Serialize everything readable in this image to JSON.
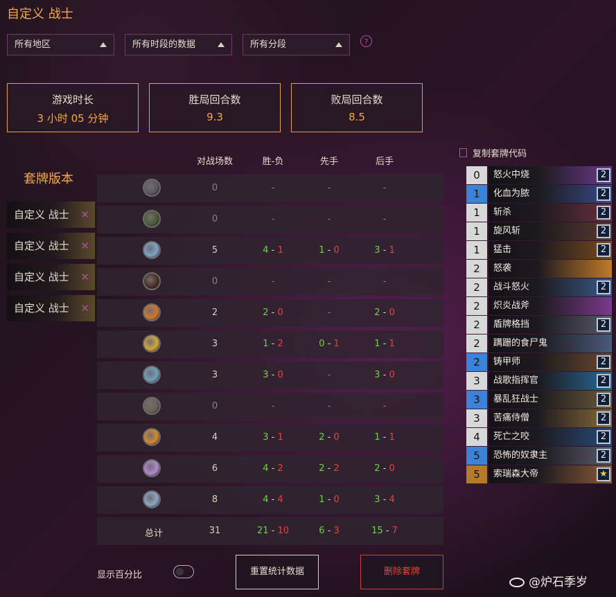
{
  "page_title": "自定义 战士",
  "filters": {
    "region": "所有地区",
    "period": "所有时段的数据",
    "rank": "所有分段",
    "help": "?"
  },
  "stats": [
    {
      "label": "游戏时长",
      "value": "3 小时 05 分钟"
    },
    {
      "label": "胜局回合数",
      "value": "9.3"
    },
    {
      "label": "败局回合数",
      "value": "8.5"
    }
  ],
  "deck_versions": {
    "title": "套牌版本",
    "items": [
      "自定义 战士",
      "自定义 战士",
      "自定义 战士",
      "自定义 战士"
    ],
    "remove_glyph": "✕"
  },
  "table": {
    "headers": [
      "对战场数",
      "胜-负",
      "先手",
      "后手"
    ],
    "rows": [
      {
        "icon": "druid-class-icon",
        "color": "#5a5860",
        "games": "0",
        "wl": null,
        "first": null,
        "second": null
      },
      {
        "icon": "hunter-class-icon",
        "color": "#4a5a34",
        "games": "0",
        "wl": null,
        "first": null,
        "second": null
      },
      {
        "icon": "mage-class-icon",
        "color": "#7aa6c8",
        "games": "5",
        "wl": [
          "4",
          "1"
        ],
        "first": [
          "1",
          "0"
        ],
        "second": [
          "3",
          "1"
        ]
      },
      {
        "icon": "paladin-class-icon",
        "color": "#4a3020",
        "games": "0",
        "wl": null,
        "first": null,
        "second": null
      },
      {
        "icon": "priest-class-icon",
        "color": "#d0782a",
        "games": "2",
        "wl": [
          "2",
          "0"
        ],
        "first": null,
        "second": [
          "2",
          "0"
        ]
      },
      {
        "icon": "rogue-class-icon",
        "color": "#d4a838",
        "games": "3",
        "wl": [
          "1",
          "2"
        ],
        "first": [
          "0",
          "1"
        ],
        "second": [
          "1",
          "1"
        ]
      },
      {
        "icon": "shaman-class-icon",
        "color": "#6aa4c0",
        "games": "3",
        "wl": [
          "3",
          "0"
        ],
        "first": null,
        "second": [
          "3",
          "0"
        ]
      },
      {
        "icon": "warlock-class-icon",
        "color": "#6a6258",
        "games": "0",
        "wl": null,
        "first": null,
        "second": null
      },
      {
        "icon": "warrior-class-icon",
        "color": "#d08a2a",
        "games": "4",
        "wl": [
          "3",
          "1"
        ],
        "first": [
          "2",
          "0"
        ],
        "second": [
          "1",
          "1"
        ]
      },
      {
        "icon": "demon-hunter-class-icon",
        "color": "#b08ad0",
        "games": "6",
        "wl": [
          "4",
          "2"
        ],
        "first": [
          "2",
          "2"
        ],
        "second": [
          "2",
          "0"
        ]
      },
      {
        "icon": "death-knight-class-icon",
        "color": "#8aa6c8",
        "games": "8",
        "wl": [
          "4",
          "4"
        ],
        "first": [
          "1",
          "0"
        ],
        "second": [
          "3",
          "4"
        ]
      }
    ],
    "empty_mark": "-",
    "total": {
      "label": "总计",
      "games": "31",
      "wl": [
        "21",
        "10"
      ],
      "first": [
        "6",
        "3"
      ],
      "second": [
        "15",
        "7"
      ]
    }
  },
  "controls": {
    "show_percent_label": "显示百分比",
    "reset_label": "重置统计数据",
    "delete_label": "删除套牌"
  },
  "deck_list": {
    "copy_label": "复制套牌代码",
    "cards": [
      {
        "cost": "0",
        "name": "怒火中烧",
        "count": "2",
        "cost_style": "gray",
        "art": "#6a3a8a"
      },
      {
        "cost": "1",
        "name": "化血为脓",
        "count": "2",
        "cost_style": "blue",
        "art": "#3a4a8a"
      },
      {
        "cost": "1",
        "name": "斩杀",
        "count": "2",
        "cost_style": "gray",
        "art": "#6a3040"
      },
      {
        "cost": "1",
        "name": "旋风斩",
        "count": "2",
        "cost_style": "gray",
        "art": "#5a3a30"
      },
      {
        "cost": "1",
        "name": "猛击",
        "count": "2",
        "cost_style": "gray",
        "art": "#7a4a20"
      },
      {
        "cost": "2",
        "name": "怒袭",
        "count": "",
        "cost_style": "gray",
        "art": "#c07a2a"
      },
      {
        "cost": "2",
        "name": "战斗怒火",
        "count": "2",
        "cost_style": "gray",
        "art": "#3a5a8a"
      },
      {
        "cost": "2",
        "name": "炽炎战斧",
        "count": "",
        "cost_style": "gray",
        "art": "#7a3a8a"
      },
      {
        "cost": "2",
        "name": "盾牌格挡",
        "count": "2",
        "cost_style": "gray",
        "art": "#5a5a6a"
      },
      {
        "cost": "2",
        "name": "蹒跚的食尸鬼",
        "count": "",
        "cost_style": "gray",
        "art": "#4a5a7a"
      },
      {
        "cost": "2",
        "name": "铸甲师",
        "count": "2",
        "cost_style": "blue",
        "art": "#6a4a30"
      },
      {
        "cost": "3",
        "name": "战歌指挥官",
        "count": "2",
        "cost_style": "gray",
        "art": "#2a6a9a"
      },
      {
        "cost": "3",
        "name": "暴乱狂战士",
        "count": "2",
        "cost_style": "blue",
        "art": "#6a5a3a"
      },
      {
        "cost": "3",
        "name": "苦痛侍僧",
        "count": "2",
        "cost_style": "gray",
        "art": "#8a6a3a"
      },
      {
        "cost": "4",
        "name": "死亡之咬",
        "count": "2",
        "cost_style": "gray",
        "art": "#2a4a7a"
      },
      {
        "cost": "5",
        "name": "恐怖的奴隶主",
        "count": "2",
        "cost_style": "blue",
        "art": "#5a5a6a"
      },
      {
        "cost": "5",
        "name": "索瑞森大帝",
        "count": "★",
        "cost_style": "gold",
        "art": "#8a5a3a"
      }
    ]
  },
  "watermark": "@炉石季岁"
}
